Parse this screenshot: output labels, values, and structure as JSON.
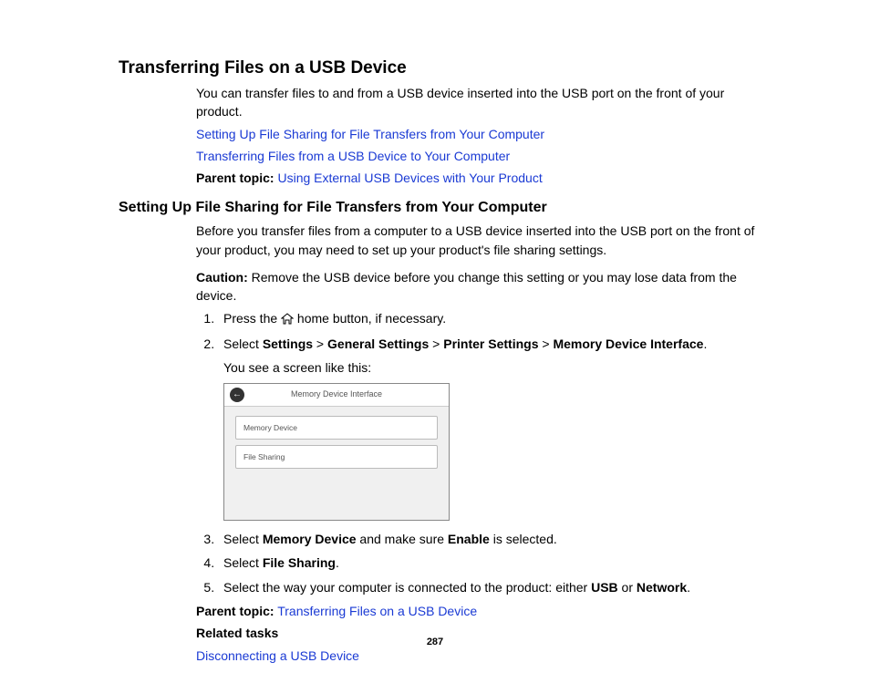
{
  "h1": "Transferring Files on a USB Device",
  "intro": "You can transfer files to and from a USB device inserted into the USB port on the front of your product.",
  "link1": "Setting Up File Sharing for File Transfers from Your Computer",
  "link2": "Transferring Files from a USB Device to Your Computer",
  "parent_label": "Parent topic:",
  "parent_link_top": "Using External USB Devices with Your Product",
  "h2": "Setting Up File Sharing for File Transfers from Your Computer",
  "before": "Before you transfer files from a computer to a USB device inserted into the USB port on the front of your product, you may need to set up your product's file sharing settings.",
  "caution_label": "Caution:",
  "caution_text": " Remove the USB device before you change this setting or you may lose data from the device.",
  "step1_a": "Press the ",
  "step1_b": " home button, if necessary.",
  "step2_select": "Select ",
  "step2_settings": "Settings",
  "step2_general": "General Settings",
  "step2_printer": "Printer Settings",
  "step2_memory": "Memory Device Interface",
  "gt": " > ",
  "period": ".",
  "step2_see": "You see a screen like this:",
  "shot_title": "Memory Device Interface",
  "shot_row1": "Memory Device",
  "shot_row2": "File Sharing",
  "step3_a": "Select ",
  "step3_mem": "Memory Device",
  "step3_b": " and make sure ",
  "step3_en": "Enable",
  "step3_c": " is selected.",
  "step4_a": "Select ",
  "step4_fs": "File Sharing",
  "step5_a": "Select the way your computer is connected to the product: either ",
  "step5_usb": "USB",
  "step5_or": " or ",
  "step5_net": "Network",
  "parent_link_bottom": "Transferring Files on a USB Device",
  "related_label": "Related tasks",
  "related_link": "Disconnecting a USB Device",
  "page_num": "287"
}
